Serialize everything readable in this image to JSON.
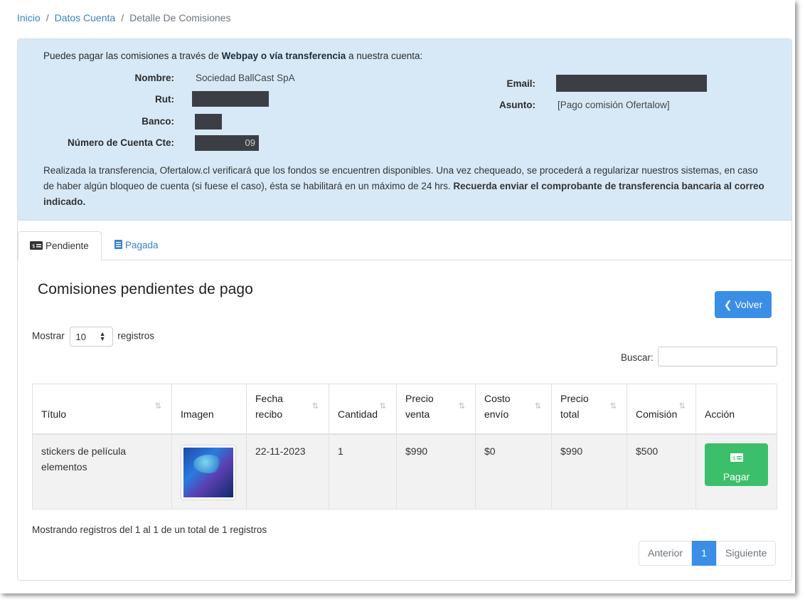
{
  "breadcrumb": {
    "home": "Inicio",
    "account": "Datos Cuenta",
    "current": "Detalle De Comisiones"
  },
  "info": {
    "intro_pre": "Puedes pagar las comisiones a través de ",
    "intro_bold": "Webpay o vía transferencia",
    "intro_post": " a nuestra cuenta:",
    "nombre_label": "Nombre:",
    "nombre_value": "Sociedad BallCast SpA",
    "rut_label": "Rut:",
    "banco_label": "Banco:",
    "cuenta_label": "Número de Cuenta Cte:",
    "cuenta_suffix": "09",
    "email_label": "Email:",
    "asunto_label": "Asunto:",
    "asunto_value": "[Pago comisión Ofertalow]",
    "note_text": "Realizada la transferencia, Ofertalow.cl verificará que los fondos se encuentren disponibles. Una vez chequeado, se procederá a regularizar nuestros sistemas, en caso de haber algún bloqueo de cuenta (si fuese el caso), ésta se habilitará en un máximo de 24 hrs. ",
    "note_bold": "Recuerda enviar el comprobante de transferencia bancaria al correo indicado."
  },
  "tabs": [
    {
      "label": "Pendiente",
      "icon": "money-icon"
    },
    {
      "label": "Pagada",
      "icon": "receipt-icon"
    }
  ],
  "section_title": "Comisiones pendientes de pago",
  "volver_label": "Volver",
  "length_menu": {
    "pre": "Mostrar",
    "value": "10",
    "post": "registros"
  },
  "search_label": "Buscar:",
  "table": {
    "headers": [
      "Título",
      "Imagen",
      "Fecha recibo",
      "Cantidad",
      "Precio venta",
      "Costo envío",
      "Precio total",
      "Comisión",
      "Acción"
    ],
    "rows": [
      {
        "titulo": "stickers de película elementos",
        "fecha": "22-11-2023",
        "cantidad": "1",
        "precio_venta": "$990",
        "costo_envio": "$0",
        "precio_total": "$990",
        "comision": "$500",
        "accion": "Pagar"
      }
    ]
  },
  "footer_info": "Mostrando registros del 1 al 1 de un total de 1 registros",
  "pager": {
    "prev": "Anterior",
    "current": "1",
    "next": "Siguiente"
  },
  "colors": {
    "primary": "#3a8ee6",
    "success": "#3cbf6b",
    "info_bg": "#d7e9f7",
    "link": "#3b82c4"
  }
}
